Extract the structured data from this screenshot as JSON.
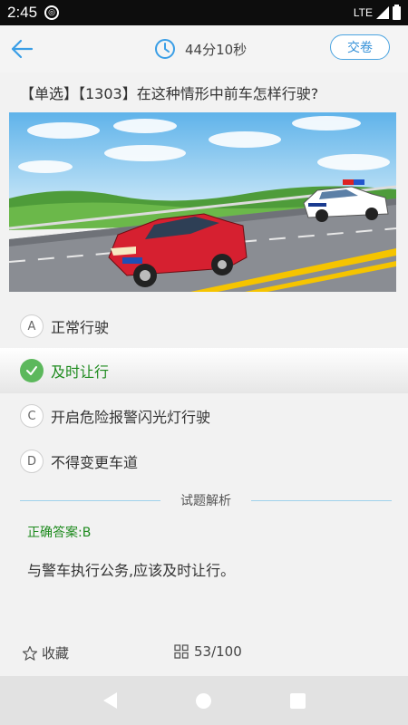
{
  "status_bar": {
    "time": "2:45",
    "network": "LTE"
  },
  "header": {
    "timer": "44分10秒",
    "submit_label": "交卷"
  },
  "question": {
    "text": "【单选】【1303】在这种情形中前车怎样行驶?"
  },
  "options": [
    {
      "letter": "A",
      "text": "正常行驶",
      "selected": false
    },
    {
      "letter": "B",
      "text": "及时让行",
      "selected": true
    },
    {
      "letter": "C",
      "text": "开启危险报警闪光灯行驶",
      "selected": false
    },
    {
      "letter": "D",
      "text": "不得变更车道",
      "selected": false
    }
  ],
  "analysis": {
    "title": "试题解析",
    "answer": "正确答案:B",
    "explanation": "与警车执行公务,应该及时让行。"
  },
  "bottom": {
    "favorite_label": "收藏",
    "progress": "53/100"
  },
  "colors": {
    "accent": "#3591d8",
    "correct": "#1d8a1d",
    "check": "#5cb85c"
  }
}
